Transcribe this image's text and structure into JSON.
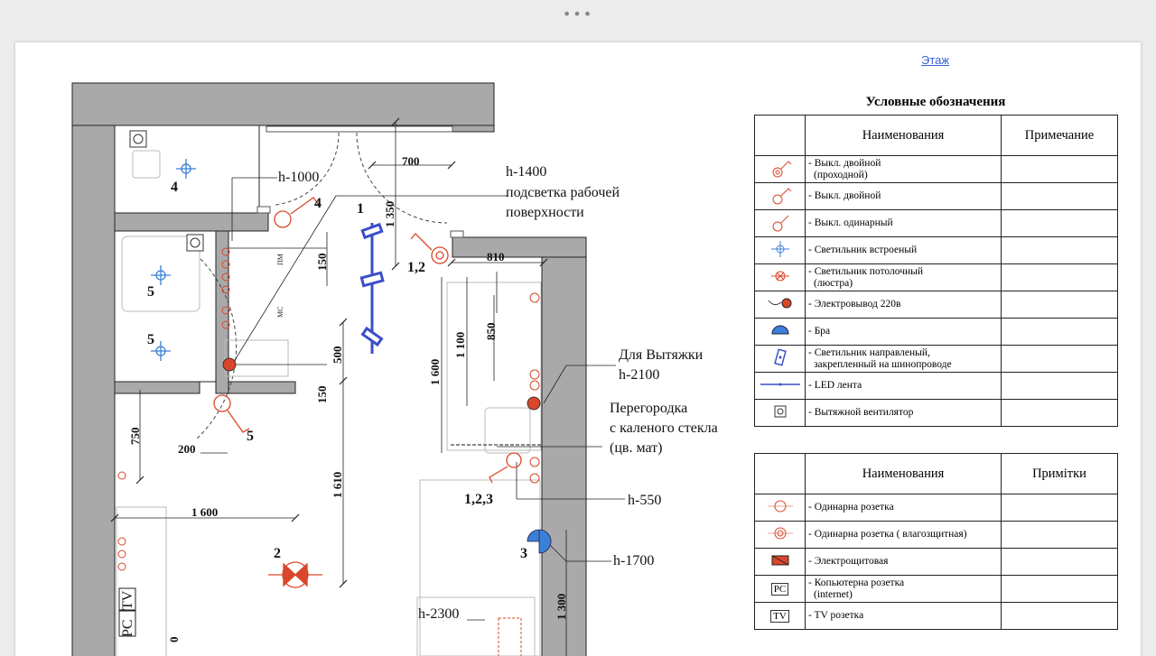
{
  "window_dots": "•••",
  "nav": {
    "floor_link": "Этаж"
  },
  "plan": {
    "rooms": [
      "4",
      "4",
      "5",
      "5",
      "5",
      "1",
      "1,2",
      "1,2,3",
      "2",
      "3"
    ],
    "notes": {
      "h1000": "h-1000",
      "h1400": "h-1400",
      "worklight_1": "подсветка рабочей",
      "worklight_2": "поверхности",
      "hood_1": "Для Вытяжки",
      "hood_2": "h-2100",
      "glass_1": "Перегородка",
      "glass_2": "с каленого стекла",
      "glass_3": "(цв. мат)",
      "h550": "h-550",
      "h1700": "h-1700",
      "h2300": "h-2300",
      "pm": "ПМ",
      "ms": "МС",
      "pc": "PC",
      "tv": "TV"
    },
    "dimensions": [
      "700",
      "1 350",
      "810",
      "150",
      "850",
      "1 100",
      "1 600",
      "500",
      "150",
      "750",
      "200",
      "1 610",
      "1 600",
      "1 300",
      "0"
    ]
  },
  "legend": {
    "title": "Условные обозначения",
    "table1": {
      "headers": {
        "name": "Наименования",
        "note": "Примечание"
      },
      "rows": [
        {
          "icon": "double-pass-switch-icon",
          "name_1": "- Выкл. двойной",
          "name_2": "(проходной)"
        },
        {
          "icon": "double-switch-icon",
          "name_1": "- Выкл. двойной",
          "name_2": ""
        },
        {
          "icon": "single-switch-icon",
          "name_1": "- Выкл.  одинарный",
          "name_2": ""
        },
        {
          "icon": "recessed-light-icon",
          "name_1": "- Светильник встроеный",
          "name_2": ""
        },
        {
          "icon": "ceiling-light-icon",
          "name_1": "- Светильник потолочный",
          "name_2": "(люстра)"
        },
        {
          "icon": "power-outlet-220-icon",
          "name_1": "- Электровывод 220в",
          "name_2": ""
        },
        {
          "icon": "sconce-icon",
          "name_1": "- Бра",
          "name_2": ""
        },
        {
          "icon": "track-spotlight-icon",
          "name_1": "- Светильник направленый,",
          "name_2": "закрепленный на шинопроводе"
        },
        {
          "icon": "led-strip-icon",
          "name_1": " - LED лента",
          "name_2": ""
        },
        {
          "icon": "exhaust-fan-icon",
          "name_1": "  - Вытяжной вентилятор",
          "name_2": ""
        }
      ]
    },
    "table2": {
      "headers": {
        "name": "Наименования",
        "note": "Примітки"
      },
      "rows": [
        {
          "icon": "single-socket-icon",
          "name_1": "- Одинарна розетка",
          "name_2": ""
        },
        {
          "icon": "waterproof-socket-icon",
          "name_1": "- Одинарна розетка ( влагозщитная)",
          "name_2": ""
        },
        {
          "icon": "electrical-panel-icon",
          "name_1": "- Электрощитовая",
          "name_2": ""
        },
        {
          "icon": "pc-socket-icon",
          "label": "PC",
          "name_1": "- Копьютерна розетка",
          "name_2": "(internet)"
        },
        {
          "icon": "tv-socket-icon",
          "label": "TV",
          "name_1": "- TV розетка",
          "name_2": ""
        }
      ]
    }
  },
  "colors": {
    "wall": "#a9a9a9",
    "red": "#d9472b",
    "blue": "#3a4fc8",
    "link": "#3a5fd0"
  }
}
